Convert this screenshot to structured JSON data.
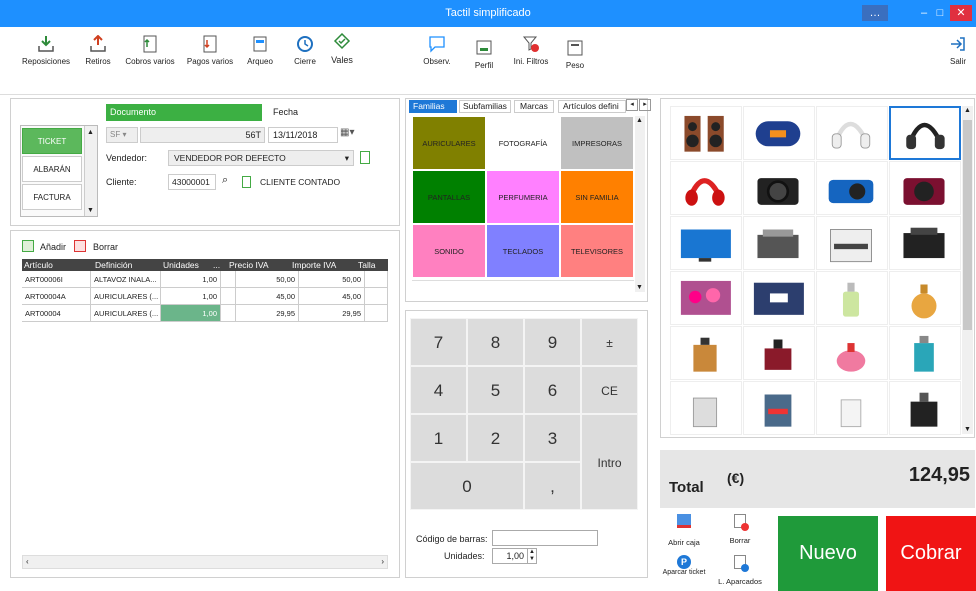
{
  "window": {
    "title": "Tactil simplificado"
  },
  "toolbar": {
    "left": [
      "Reposiciones",
      "Retiros",
      "Cobros varios",
      "Pagos varios",
      "Arqueo",
      "Cierre",
      "Vales"
    ],
    "mid": [
      "Observ.",
      "Perfil",
      "Ini. Filtros",
      "Peso"
    ],
    "exit": "Salir"
  },
  "document": {
    "label": "Documento",
    "date_label": "Fecha",
    "types": [
      "TICKET",
      "ALBARÁN",
      "FACTURA"
    ],
    "series": "SF",
    "number": "56T",
    "date": "13/11/2018",
    "seller_label": "Vendedor:",
    "seller": "VENDEDOR POR DEFECTO",
    "client_label": "Cliente:",
    "client_code": "43000001",
    "client_name": "CLIENTE CONTADO"
  },
  "lines": {
    "add": "Añadir",
    "delete": "Borrar",
    "headers": [
      "Artículo",
      "Definición",
      "Unidades",
      "...",
      "Precio IVA",
      "Importe IVA",
      "Talla"
    ],
    "rows": [
      [
        "ART00006I",
        "ALTAVOZ INALA...",
        "1,00",
        "",
        "50,00",
        "50,00",
        ""
      ],
      [
        "ART00004A",
        "AURICULARES (...",
        "1,00",
        "",
        "45,00",
        "45,00",
        ""
      ],
      [
        "ART00004",
        "AURICULARES (...",
        "1,00",
        "",
        "29,95",
        "29,95",
        ""
      ]
    ]
  },
  "catalog": {
    "tabs": [
      "Familias",
      "Subfamilias",
      "Marcas",
      "Artículos defini"
    ],
    "families": [
      {
        "name": "AURICULARES",
        "color": "#808000"
      },
      {
        "name": "FOTOGRAFÍA",
        "color": "#ffffff"
      },
      {
        "name": "IMPRESORAS",
        "color": "#c0c0c0"
      },
      {
        "name": "PANTALLAS",
        "color": "#008000"
      },
      {
        "name": "PERFUMERIA",
        "color": "#ff80ff"
      },
      {
        "name": "SIN FAMILIA",
        "color": "#ff8000"
      },
      {
        "name": "SONIDO",
        "color": "#ff80c0"
      },
      {
        "name": "TECLADOS",
        "color": "#8080ff"
      },
      {
        "name": "TELEVISORES",
        "color": "#ff8080"
      }
    ]
  },
  "keypad": {
    "keys": [
      "7",
      "8",
      "9",
      "±",
      "4",
      "5",
      "6",
      "CE",
      "1",
      "2",
      "3",
      "Intro",
      "0",
      ","
    ],
    "barcode_label": "Código de barras:",
    "units_label": "Unidades:",
    "units": "1,00"
  },
  "products": [
    "speakers",
    "bluetooth-speaker",
    "white-headset",
    "black-headset",
    "red-headphones",
    "camera-black",
    "camera-blue",
    "camera-red",
    "tv",
    "printer",
    "multifunction-printer",
    "inkjet-printer",
    "flower-tv",
    "led-tv",
    "perfume-green",
    "perfume-gold",
    "perfume-gio",
    "perfume-bvlgari",
    "perfume-pink",
    "perfume-ck",
    "perfume-issey",
    "perfume-hugo",
    "perfume-lacoste",
    "perfume-black"
  ],
  "totals": {
    "label": "Total",
    "currency": "(€)",
    "value": "124,95"
  },
  "actions": {
    "open_drawer": "Abrir caja",
    "delete": "Borrar",
    "park": "Aparcar ticket",
    "parked": "L. Aparcados",
    "new": "Nuevo",
    "charge": "Cobrar"
  },
  "colors": {
    "accent": "#1e90ff",
    "doc_green": "#3cb043",
    "new_green": "#1f9a3a",
    "charge_red": "#f01414"
  }
}
